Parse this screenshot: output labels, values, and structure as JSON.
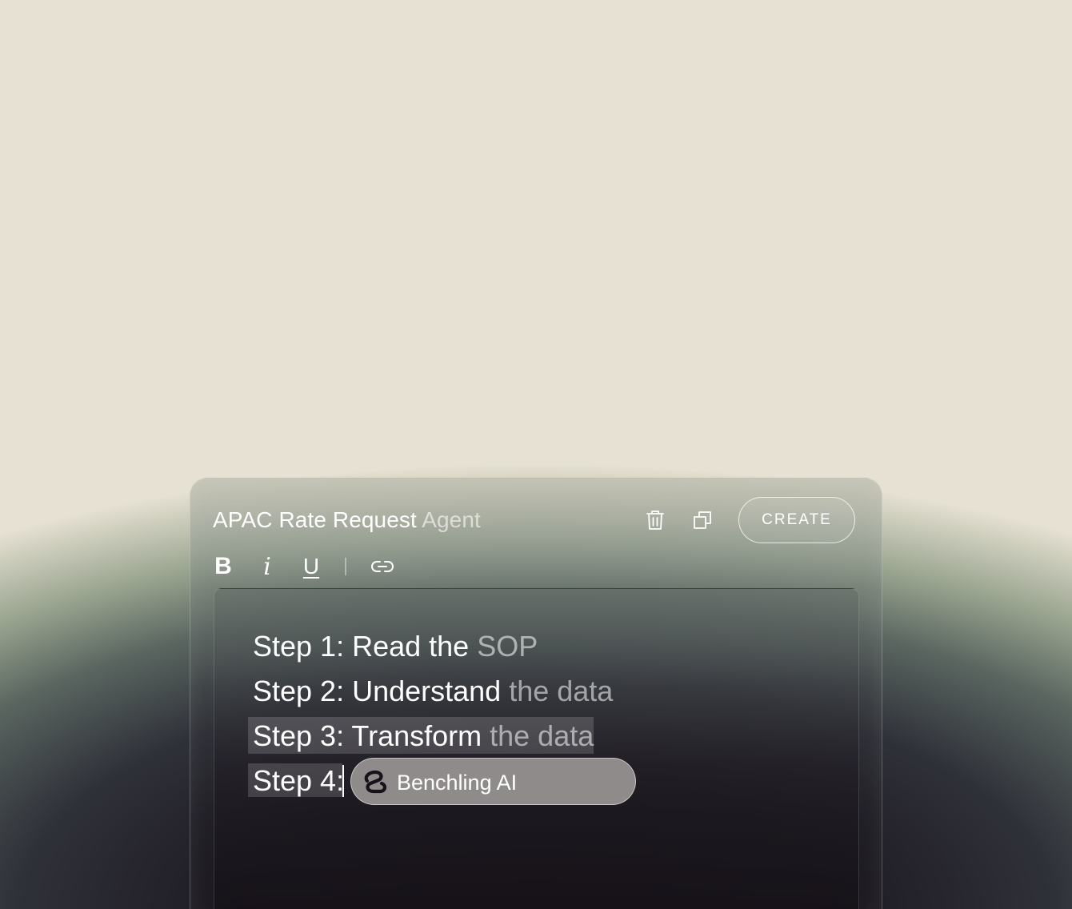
{
  "header": {
    "title_main": "APAC Rate Request ",
    "title_muted": "Agent",
    "create_label": "CREATE",
    "icons": [
      "trash-icon",
      "copy-icon"
    ]
  },
  "toolbar": {
    "bold": "B",
    "italic": "i",
    "underline": "U",
    "link_icon": "link-icon"
  },
  "editor": {
    "lines": [
      {
        "strong": "Step 1: Read the ",
        "dim": "SOP"
      },
      {
        "strong": "Step 2: Understand ",
        "dim": "the data"
      },
      {
        "strong": "Step 3: Transform ",
        "dim": "the data"
      },
      {
        "strong": "Step 4:",
        "dim": ""
      }
    ]
  },
  "suggestion": {
    "label": "Benchling AI",
    "icon": "benchling-logo-icon",
    "background": "#8f8b8b"
  }
}
